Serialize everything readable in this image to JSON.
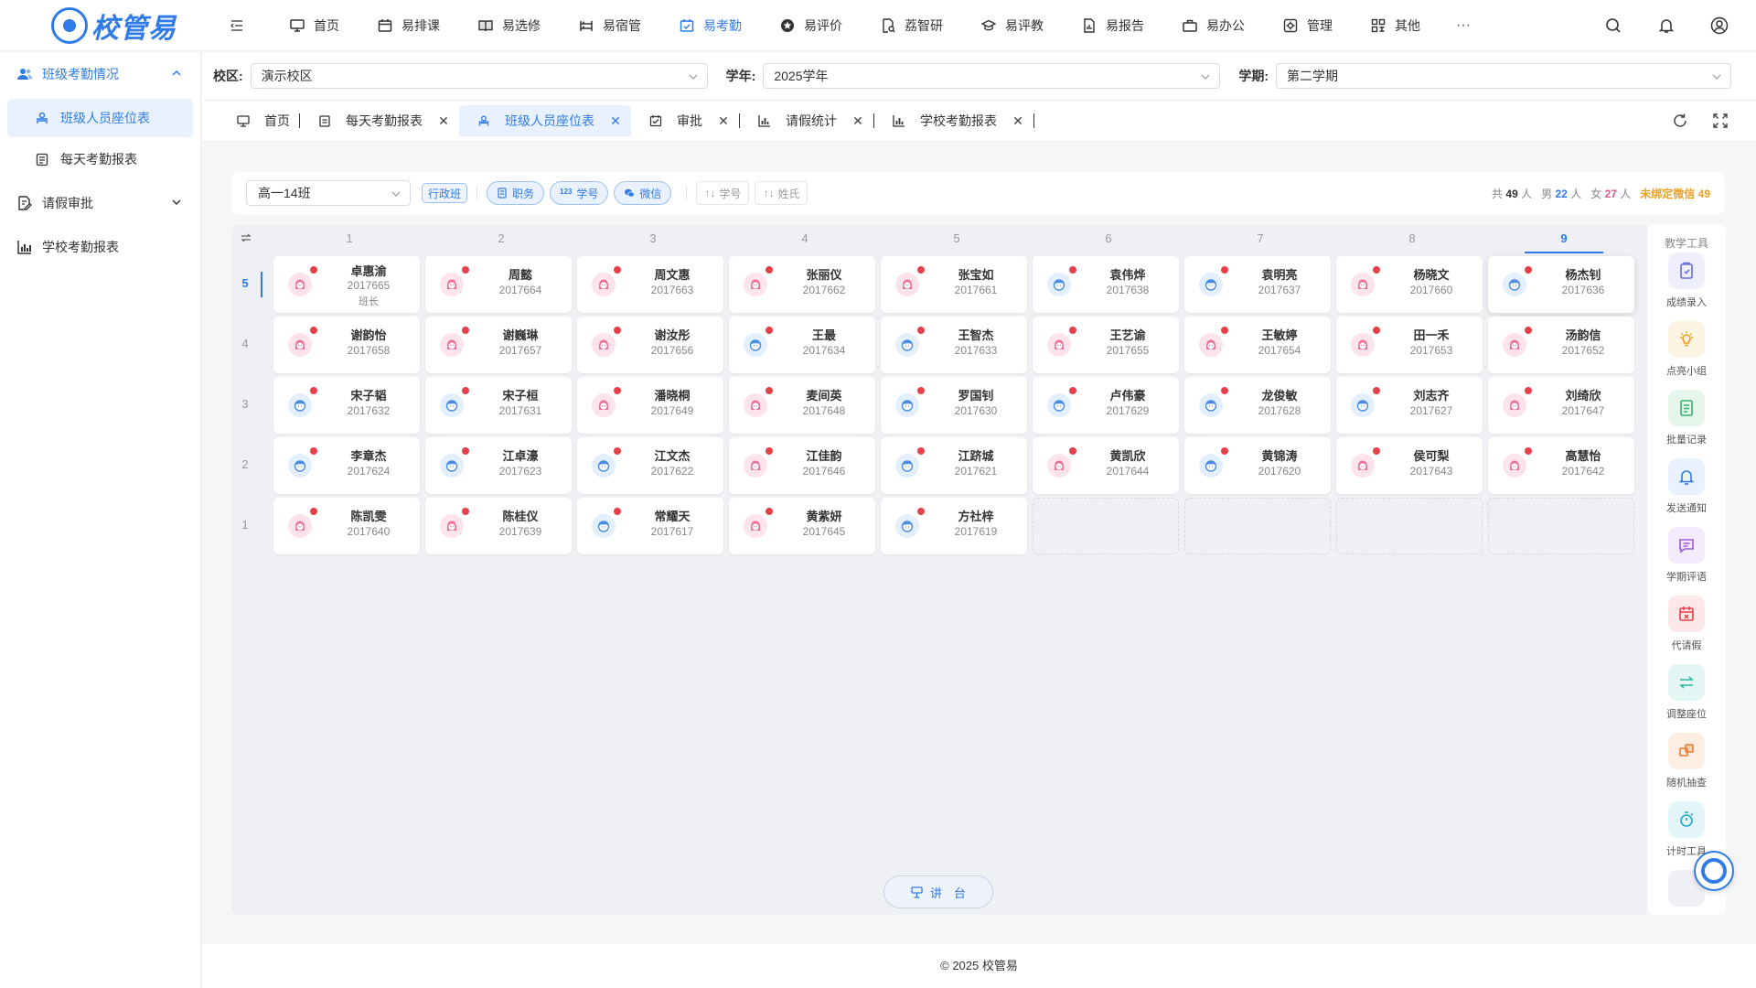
{
  "app": {
    "logo_text": "校管易"
  },
  "nav": [
    {
      "label": "首页",
      "icon": "monitor-icon"
    },
    {
      "label": "易排课",
      "icon": "calendar-icon"
    },
    {
      "label": "易选修",
      "icon": "book-icon"
    },
    {
      "label": "易宿管",
      "icon": "bunk-icon"
    },
    {
      "label": "易考勤",
      "icon": "calendar-check-icon",
      "active": true
    },
    {
      "label": "易评价",
      "icon": "star-icon"
    },
    {
      "label": "荔智研",
      "icon": "research-icon"
    },
    {
      "label": "易评教",
      "icon": "graduation-icon"
    },
    {
      "label": "易报告",
      "icon": "report-icon"
    },
    {
      "label": "易办公",
      "icon": "briefcase-icon"
    },
    {
      "label": "管理",
      "icon": "gear-icon"
    },
    {
      "label": "其他",
      "icon": "grid-icon"
    }
  ],
  "nav_more": "···",
  "sidebar": {
    "group1": "班级考勤情况",
    "sub1": "班级人员座位表",
    "sub2": "每天考勤报表",
    "group2": "请假审批",
    "group3": "学校考勤报表"
  },
  "filters": {
    "campus_label": "校区:",
    "campus_value": "演示校区",
    "year_label": "学年:",
    "year_value": "2025学年",
    "term_label": "学期:",
    "term_value": "第二学期"
  },
  "tabs": [
    "首页",
    "每天考勤报表",
    "班级人员座位表",
    "审批",
    "请假统计",
    "学校考勤报表"
  ],
  "toolbar": {
    "class_value": "高一14班",
    "class_tag": "行政班",
    "pill_duty": "职务",
    "pill_id": "学号",
    "pill_wechat": "微信",
    "sort_id": "学号",
    "sort_surname": "姓氏",
    "stat_total_pre": "共",
    "stat_total": "49",
    "stat_total_unit": "人",
    "stat_male_pre": "男",
    "stat_male": "22",
    "stat_male_unit": "人",
    "stat_female_pre": "女",
    "stat_female": "27",
    "stat_female_unit": "人",
    "stat_unbound_pre": "未绑定微信",
    "stat_unbound": "49"
  },
  "seating": {
    "columns": [
      "1",
      "2",
      "3",
      "4",
      "5",
      "6",
      "7",
      "8",
      "9"
    ],
    "active_column": 8,
    "rows": [
      {
        "label": "5",
        "active": true,
        "seats": [
          {
            "name": "卓惠渝",
            "id": "2017665",
            "g": "f",
            "role": "班长"
          },
          {
            "name": "周懿",
            "id": "2017664",
            "g": "f"
          },
          {
            "name": "周文惠",
            "id": "2017663",
            "g": "f"
          },
          {
            "name": "张丽仪",
            "id": "2017662",
            "g": "f"
          },
          {
            "name": "张宝如",
            "id": "2017661",
            "g": "f"
          },
          {
            "name": "袁伟烨",
            "id": "2017638",
            "g": "m"
          },
          {
            "name": "袁明亮",
            "id": "2017637",
            "g": "m"
          },
          {
            "name": "杨晓文",
            "id": "2017660",
            "g": "f"
          },
          {
            "name": "杨杰钊",
            "id": "2017636",
            "g": "m",
            "selected": true
          }
        ]
      },
      {
        "label": "4",
        "seats": [
          {
            "name": "谢韵怡",
            "id": "2017658",
            "g": "f"
          },
          {
            "name": "谢巍琳",
            "id": "2017657",
            "g": "f"
          },
          {
            "name": "谢汝彤",
            "id": "2017656",
            "g": "f"
          },
          {
            "name": "王最",
            "id": "2017634",
            "g": "m"
          },
          {
            "name": "王智杰",
            "id": "2017633",
            "g": "m"
          },
          {
            "name": "王艺谕",
            "id": "2017655",
            "g": "f"
          },
          {
            "name": "王敏婷",
            "id": "2017654",
            "g": "f"
          },
          {
            "name": "田一禾",
            "id": "2017653",
            "g": "f"
          },
          {
            "name": "汤韵信",
            "id": "2017652",
            "g": "f"
          }
        ]
      },
      {
        "label": "3",
        "seats": [
          {
            "name": "宋子韬",
            "id": "2017632",
            "g": "m"
          },
          {
            "name": "宋子桓",
            "id": "2017631",
            "g": "m"
          },
          {
            "name": "潘晓桐",
            "id": "2017649",
            "g": "f"
          },
          {
            "name": "麦间英",
            "id": "2017648",
            "g": "f"
          },
          {
            "name": "罗国钊",
            "id": "2017630",
            "g": "m"
          },
          {
            "name": "卢伟豪",
            "id": "2017629",
            "g": "m"
          },
          {
            "name": "龙俊敏",
            "id": "2017628",
            "g": "m"
          },
          {
            "name": "刘志齐",
            "id": "2017627",
            "g": "m"
          },
          {
            "name": "刘绮欣",
            "id": "2017647",
            "g": "f"
          }
        ]
      },
      {
        "label": "2",
        "seats": [
          {
            "name": "李章杰",
            "id": "2017624",
            "g": "m"
          },
          {
            "name": "江卓濠",
            "id": "2017623",
            "g": "m"
          },
          {
            "name": "江文杰",
            "id": "2017622",
            "g": "m"
          },
          {
            "name": "江佳韵",
            "id": "2017646",
            "g": "f"
          },
          {
            "name": "江跻城",
            "id": "2017621",
            "g": "m"
          },
          {
            "name": "黄凯欣",
            "id": "2017644",
            "g": "f"
          },
          {
            "name": "黄锦涛",
            "id": "2017620",
            "g": "m"
          },
          {
            "name": "侯可梨",
            "id": "2017643",
            "g": "f"
          },
          {
            "name": "高慧怡",
            "id": "2017642",
            "g": "f"
          }
        ]
      },
      {
        "label": "1",
        "seats": [
          {
            "name": "陈凯雯",
            "id": "2017640",
            "g": "f"
          },
          {
            "name": "陈桂仪",
            "id": "2017639",
            "g": "f"
          },
          {
            "name": "常耀天",
            "id": "2017617",
            "g": "m"
          },
          {
            "name": "黄紫妍",
            "id": "2017645",
            "g": "f"
          },
          {
            "name": "方社梓",
            "id": "2017619",
            "g": "m"
          },
          null,
          null,
          null,
          null
        ]
      }
    ]
  },
  "podium_label": "讲　台",
  "tools": {
    "title": "教学工具",
    "items": [
      {
        "label": "成绩录入",
        "icon": "grade-entry-icon",
        "color": "#6b6fd9",
        "bg": "#eeeefc"
      },
      {
        "label": "点亮小组",
        "icon": "bulb-icon",
        "color": "#f0a020",
        "bg": "#fdf4e4"
      },
      {
        "label": "批量记录",
        "icon": "batch-record-icon",
        "color": "#2fb36b",
        "bg": "#e6f6ec"
      },
      {
        "label": "发送通知",
        "icon": "bell-icon",
        "color": "#2f7be8",
        "bg": "#e8f1fd"
      },
      {
        "label": "学期评语",
        "icon": "comment-icon",
        "color": "#9b59d6",
        "bg": "#f3eafb"
      },
      {
        "label": "代请假",
        "icon": "leave-icon",
        "color": "#e8404a",
        "bg": "#fde8e9"
      },
      {
        "label": "调整座位",
        "icon": "swap-icon",
        "color": "#2fb3a0",
        "bg": "#e4f6f3"
      },
      {
        "label": "随机抽查",
        "icon": "random-icon",
        "color": "#f07a30",
        "bg": "#fdeee4"
      },
      {
        "label": "计时工具",
        "icon": "timer-icon",
        "color": "#20a8c8",
        "bg": "#e3f5f9"
      }
    ]
  },
  "footer": "© 2025 校管易"
}
